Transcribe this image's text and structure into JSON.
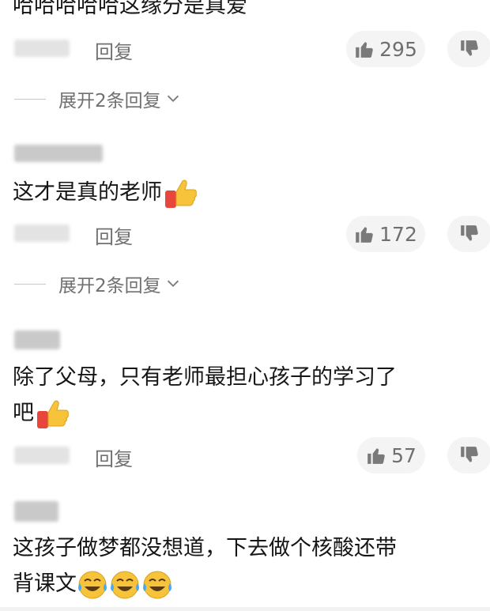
{
  "comments": [
    {
      "text": "哈哈哈哈哈这缘分是真爱",
      "reply_label": "回复",
      "likes": "295",
      "expand_label": "展开2条回复"
    },
    {
      "text": "这才是真的老师",
      "reply_label": "回复",
      "likes": "172",
      "expand_label": "展开2条回复",
      "emoji": "thumbs-up"
    },
    {
      "text_line1": "除了父母，只有老师最担心孩子的学习了",
      "text_line2": "吧",
      "reply_label": "回复",
      "likes": "57",
      "emoji": "thumbs-up"
    },
    {
      "text_line1": "这孩子做梦都没想道，下去做个核酸还带",
      "text_line2": "背课文",
      "emoji": "crying-laughing-face"
    }
  ],
  "colors": {
    "text": "#161616",
    "meta": "#707070",
    "pill_bg": "#f4f4f4",
    "thumb_yellow": "#f6c33a",
    "sleeve_red": "#e8463c"
  }
}
